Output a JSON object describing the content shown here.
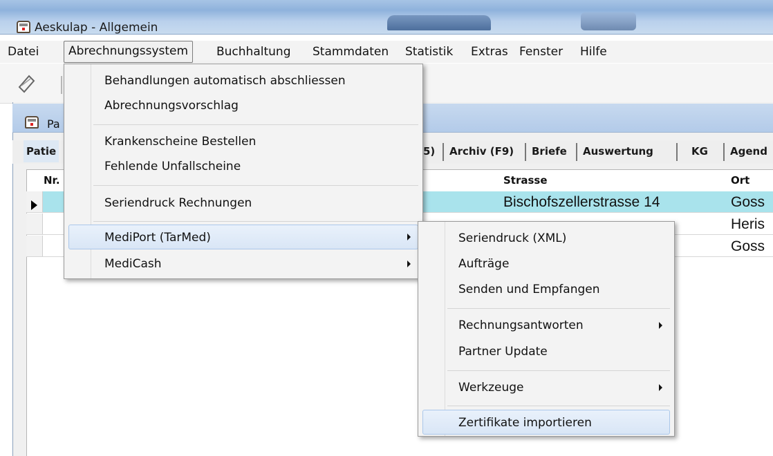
{
  "window": {
    "title": "Aeskulap - Allgemein"
  },
  "menubar": {
    "items": [
      "Datei",
      "Abrechnungssystem",
      "Buchhaltung",
      "Stammdaten",
      "Statistik",
      "Extras",
      "Fenster",
      "Hilfe"
    ]
  },
  "inner_window": {
    "title": "Pa",
    "tabs": [
      "Patie",
      "5)",
      "Archiv (F9)",
      "Briefe",
      "Auswertung",
      "KG",
      "Agend"
    ]
  },
  "grid": {
    "headers": {
      "nr": "Nr.",
      "strasse": "Strasse",
      "ort": "Ort"
    },
    "rows": [
      {
        "strasse": "Bischofszellerstrasse 14",
        "ort": "Goss"
      },
      {
        "strasse": "",
        "ort": "Heris"
      },
      {
        "strasse": "",
        "ort": "Goss"
      }
    ]
  },
  "menu_abrechnung": {
    "items": [
      "Behandlungen automatisch abschliessen",
      "Abrechnungsvorschlag",
      "Krankenscheine Bestellen",
      "Fehlende Unfallscheine",
      "Seriendruck Rechnungen",
      "MediPort (TarMed)",
      "MediCash"
    ]
  },
  "menu_mediport": {
    "items": [
      "Seriendruck (XML)",
      "Aufträge",
      "Senden und Empfangen",
      "Rechnungsantworten",
      "Partner Update",
      "Werkzeuge",
      "Zertifikate importieren"
    ]
  },
  "icons": {
    "app": "app-window-icon",
    "toolbar_first": "pen-tool-icon",
    "submenu": "submenu-arrow-icon"
  }
}
